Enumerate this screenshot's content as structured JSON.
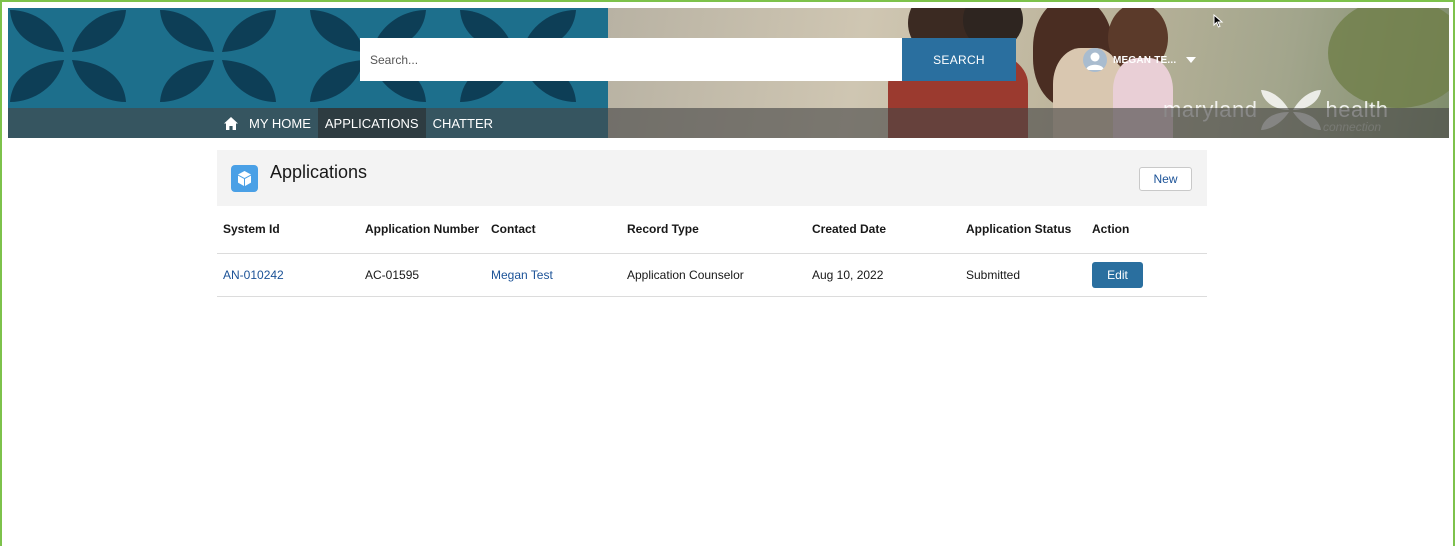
{
  "header": {
    "search": {
      "placeholder": "Search...",
      "button_label": "SEARCH"
    },
    "user": {
      "name": "MEGAN TE...",
      "avatar_icon": "user-avatar-icon",
      "menu_icon": "caret-down-icon"
    },
    "brand": {
      "word1": "maryland",
      "word2": "health",
      "sub": "connection"
    },
    "nav": {
      "home_icon": "home-icon",
      "items": [
        {
          "label": "MY HOME",
          "active": false
        },
        {
          "label": "APPLICATIONS",
          "active": true
        },
        {
          "label": "CHATTER",
          "active": false
        }
      ]
    },
    "colors": {
      "pattern": "#1d6f8c",
      "button": "#2a6f9f",
      "nav_overlay": "#464646"
    }
  },
  "list": {
    "title": "Applications",
    "object_icon": "application-cube-icon",
    "new_button": "New",
    "columns": [
      "System Id",
      "Application Number",
      "Contact",
      "Record Type",
      "Created Date",
      "Application Status",
      "Action"
    ],
    "rows": [
      {
        "system_id": "AN-010242",
        "application_number": "AC-01595",
        "contact": "Megan Test",
        "record_type": "Application Counselor",
        "created_date": "Aug 10, 2022",
        "status": "Submitted",
        "action": "Edit"
      }
    ],
    "colors": {
      "link": "#1b5297",
      "object_icon_bg": "#4aa0e6",
      "frame_border": "#7dc24b"
    }
  }
}
